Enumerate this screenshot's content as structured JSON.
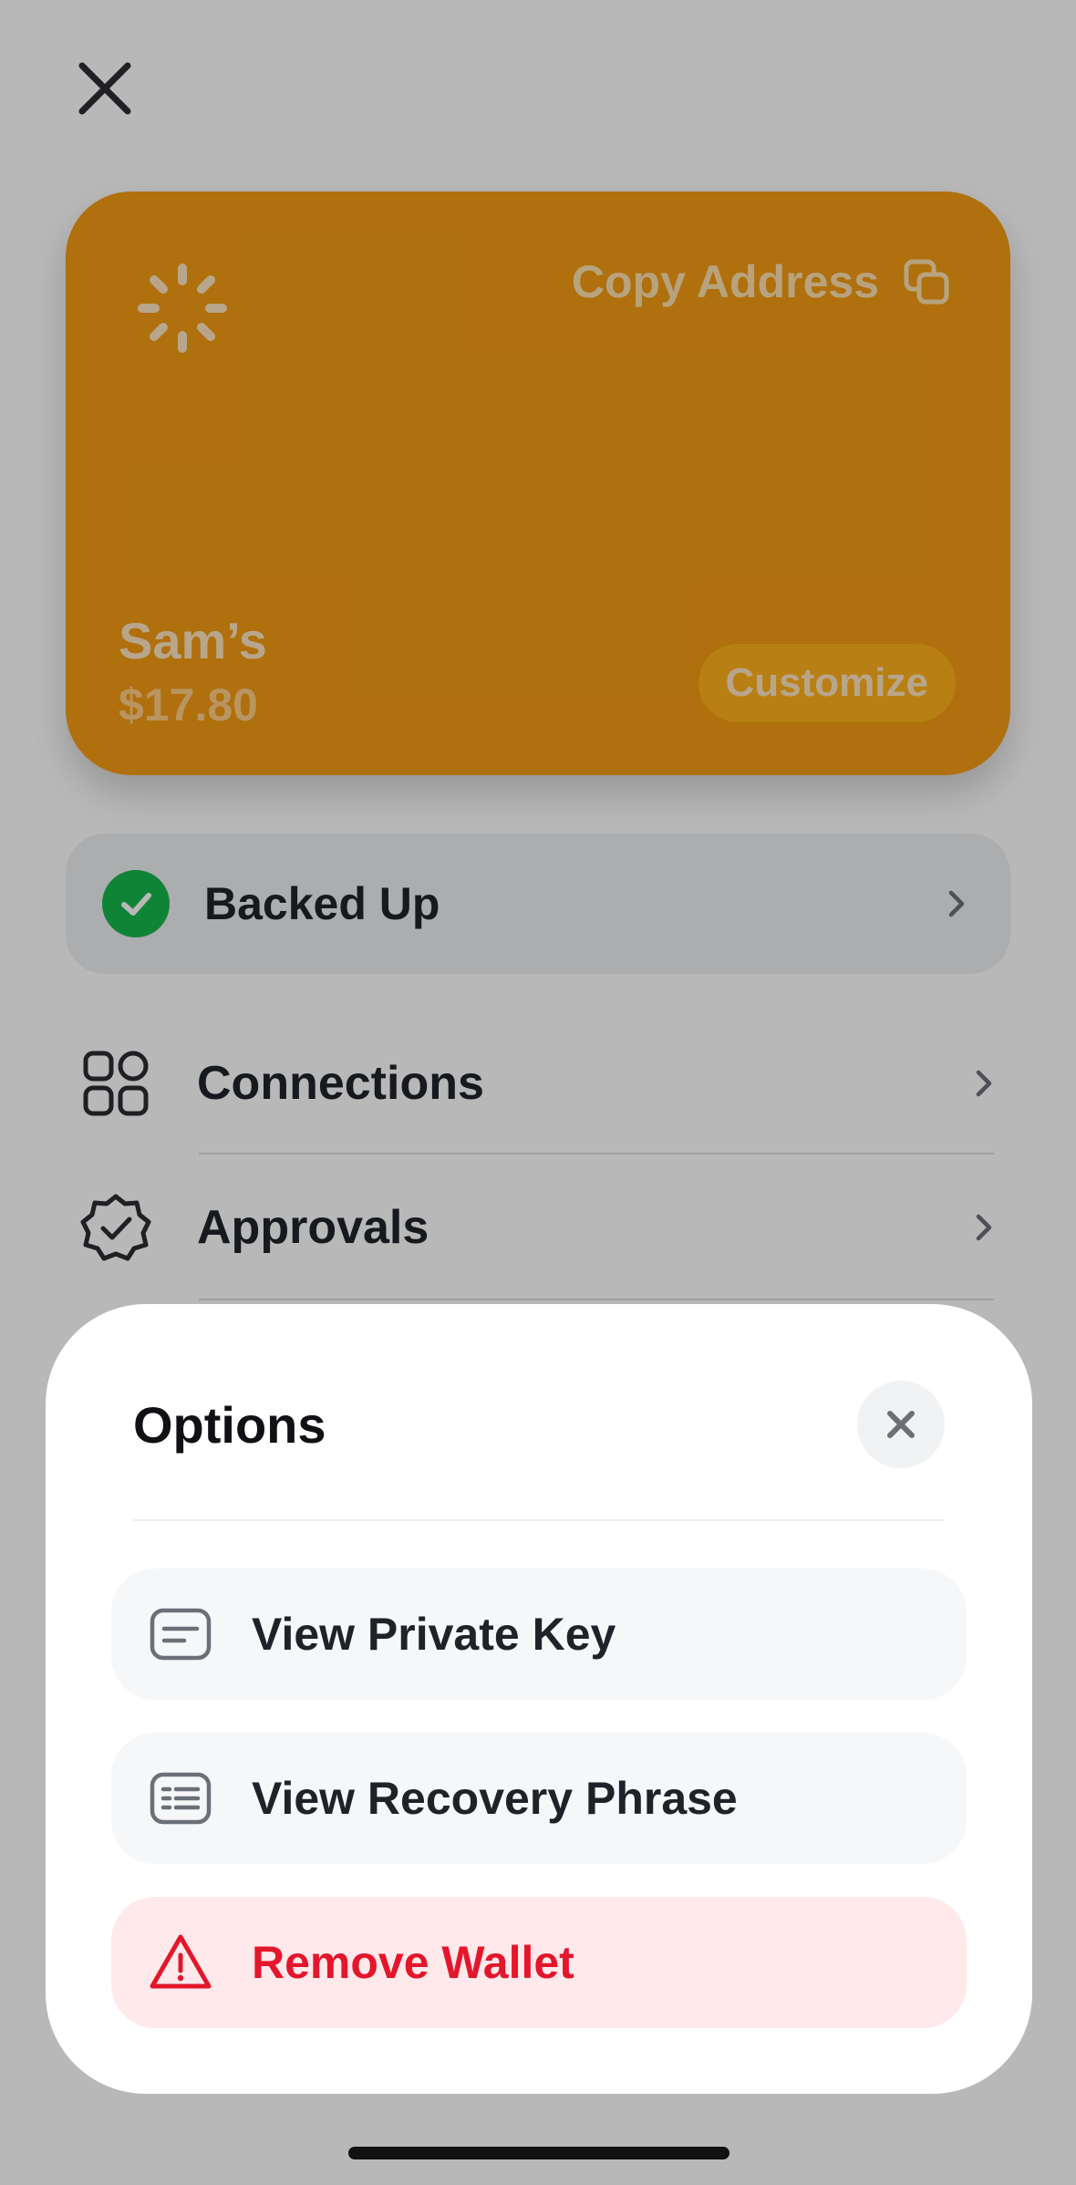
{
  "card": {
    "copy_label": "Copy Address",
    "name": "Sam’s",
    "balance": "$17.80",
    "customize_label": "Customize",
    "color": "#f39c12"
  },
  "backup": {
    "label": "Backed Up",
    "icon": "check-circle-icon",
    "color": "#16b84c"
  },
  "menu": [
    {
      "label": "Connections",
      "icon": "grid-icon"
    },
    {
      "label": "Approvals",
      "icon": "badge-check-icon"
    }
  ],
  "sheet": {
    "title": "Options",
    "options": [
      {
        "label": "View Private Key",
        "icon": "key-card-icon"
      },
      {
        "label": "View Recovery Phrase",
        "icon": "list-card-icon"
      },
      {
        "label": "Remove Wallet",
        "icon": "warning-icon",
        "color": "#e3162c"
      }
    ]
  }
}
